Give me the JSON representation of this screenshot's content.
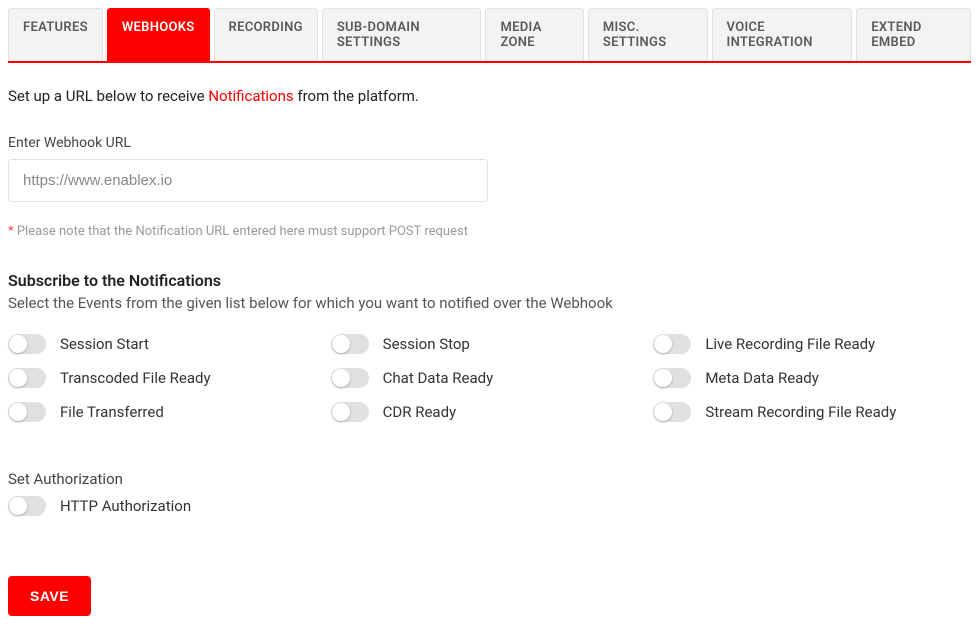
{
  "tabs": [
    {
      "label": "FEATURES",
      "active": false
    },
    {
      "label": "WEBHOOKS",
      "active": true
    },
    {
      "label": "RECORDING",
      "active": false
    },
    {
      "label": "SUB-DOMAIN SETTINGS",
      "active": false
    },
    {
      "label": "MEDIA ZONE",
      "active": false
    },
    {
      "label": "MISC. SETTINGS",
      "active": false
    },
    {
      "label": "VOICE INTEGRATION",
      "active": false
    },
    {
      "label": "EXTEND EMBED",
      "active": false
    }
  ],
  "intro": {
    "prefix": "Set up a URL below to receive ",
    "link": "Notifications",
    "suffix": " from the platform."
  },
  "url_field": {
    "label": "Enter Webhook URL",
    "placeholder": "https://www.enablex.io",
    "value": ""
  },
  "note": {
    "ast": "* ",
    "text": "Please note that the Notification URL entered here must support POST request"
  },
  "subscribe": {
    "title": "Subscribe to the Notifications",
    "desc": "Select the Events from the given list below for which you want to notified over the Webhook"
  },
  "events": [
    {
      "label": "Session Start"
    },
    {
      "label": "Session Stop"
    },
    {
      "label": "Live Recording File Ready"
    },
    {
      "label": "Transcoded File Ready"
    },
    {
      "label": "Chat Data Ready"
    },
    {
      "label": "Meta Data Ready"
    },
    {
      "label": "File Transferred"
    },
    {
      "label": "CDR Ready"
    },
    {
      "label": "Stream Recording File Ready"
    }
  ],
  "auth": {
    "label": "Set Authorization",
    "toggle_label": "HTTP Authorization"
  },
  "save": {
    "label": "SAVE"
  }
}
